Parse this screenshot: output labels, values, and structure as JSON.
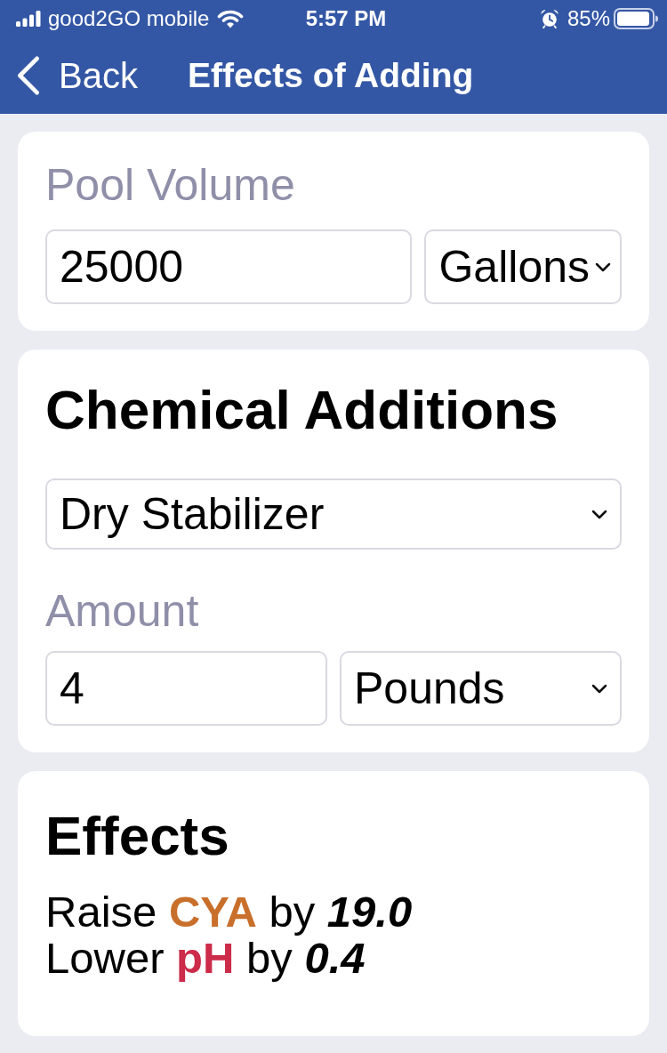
{
  "status_bar": {
    "carrier": "good2GO mobile",
    "time": "5:57 PM",
    "battery": "85%"
  },
  "nav_bar": {
    "back": "Back",
    "title": "Effects of Adding"
  },
  "pool_volume": {
    "label": "Pool Volume",
    "value": "25000",
    "unit": "Gallons"
  },
  "chemical_additions": {
    "title": "Chemical Additions",
    "chemical": "Dry Stabilizer",
    "amount_label": "Amount",
    "amount": "4",
    "unit": "Pounds"
  },
  "effects": {
    "title": "Effects",
    "items": [
      {
        "action": "Raise",
        "parameter": "CYA",
        "color": "#c96f2c",
        "connector": "by",
        "amount": "19.0"
      },
      {
        "action": "Lower",
        "parameter": "pH",
        "color": "#cc2b4a",
        "connector": "by",
        "amount": "0.4"
      }
    ]
  }
}
